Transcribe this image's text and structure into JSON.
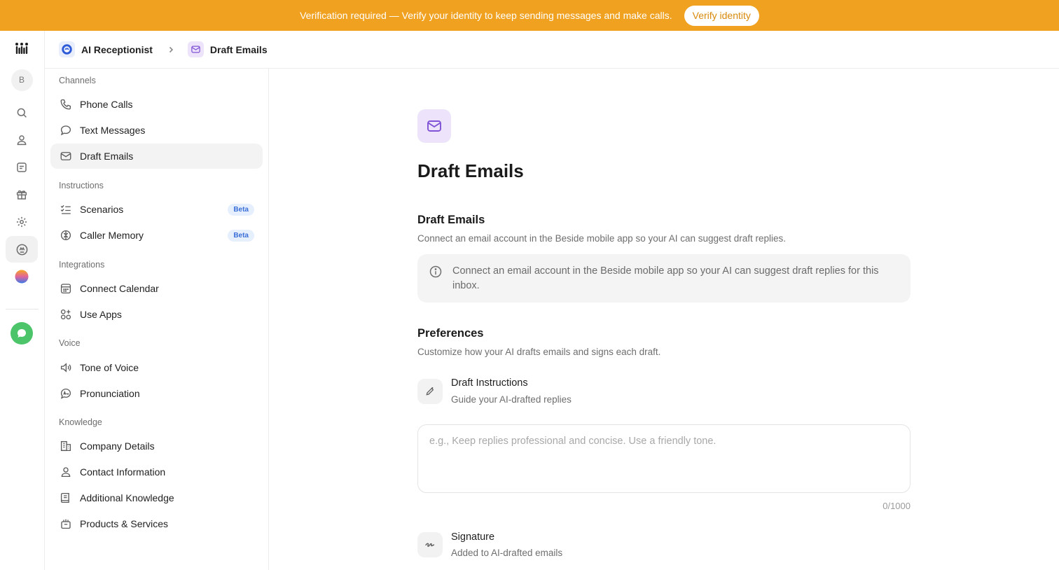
{
  "banner": {
    "text": "Verification required — Verify your identity to keep sending messages and make calls.",
    "button_label": "Verify identity"
  },
  "rail": {
    "avatar_initial": "B",
    "items": [
      "logo-icon",
      "search-icon",
      "person-icon",
      "notes-icon",
      "gift-icon",
      "settings-icon",
      "ai-receptionist-icon",
      "gradient-orb-icon",
      "chat-bubble-icon"
    ]
  },
  "breadcrumb": {
    "parent": "AI Receptionist",
    "current": "Draft Emails"
  },
  "sidebar": {
    "channels_label": "Channels",
    "phone_calls": "Phone Calls",
    "text_messages": "Text Messages",
    "draft_emails": "Draft Emails",
    "instructions_label": "Instructions",
    "scenarios": "Scenarios",
    "caller_memory": "Caller Memory",
    "beta_badge": "Beta",
    "integrations_label": "Integrations",
    "connect_calendar": "Connect Calendar",
    "use_apps": "Use Apps",
    "voice_label": "Voice",
    "tone_of_voice": "Tone of Voice",
    "pronunciation": "Pronunciation",
    "knowledge_label": "Knowledge",
    "company_details": "Company Details",
    "contact_information": "Contact Information",
    "additional_knowledge": "Additional Knowledge",
    "products_services": "Products & Services"
  },
  "main": {
    "page_title": "Draft Emails",
    "section1_title": "Draft Emails",
    "section1_desc": "Connect an email account in the Beside mobile app so your AI can suggest draft replies.",
    "info_text": "Connect an email account in the Beside mobile app so your AI can suggest draft replies for this inbox.",
    "preferences_title": "Preferences",
    "preferences_desc": "Customize how your AI drafts emails and signs each draft.",
    "draft_instructions_title": "Draft Instructions",
    "draft_instructions_sub": "Guide your AI-drafted replies",
    "instructions_placeholder": "e.g., Keep replies professional and concise. Use a friendly tone.",
    "char_counter": "0/1000",
    "signature_title": "Signature",
    "signature_sub": "Added to AI-drafted emails"
  },
  "colors": {
    "banner": "#f0a11f",
    "accent_purple": "#7f52d6",
    "beta_blue": "#3a6fd8",
    "chat_green": "#4cc46a"
  }
}
